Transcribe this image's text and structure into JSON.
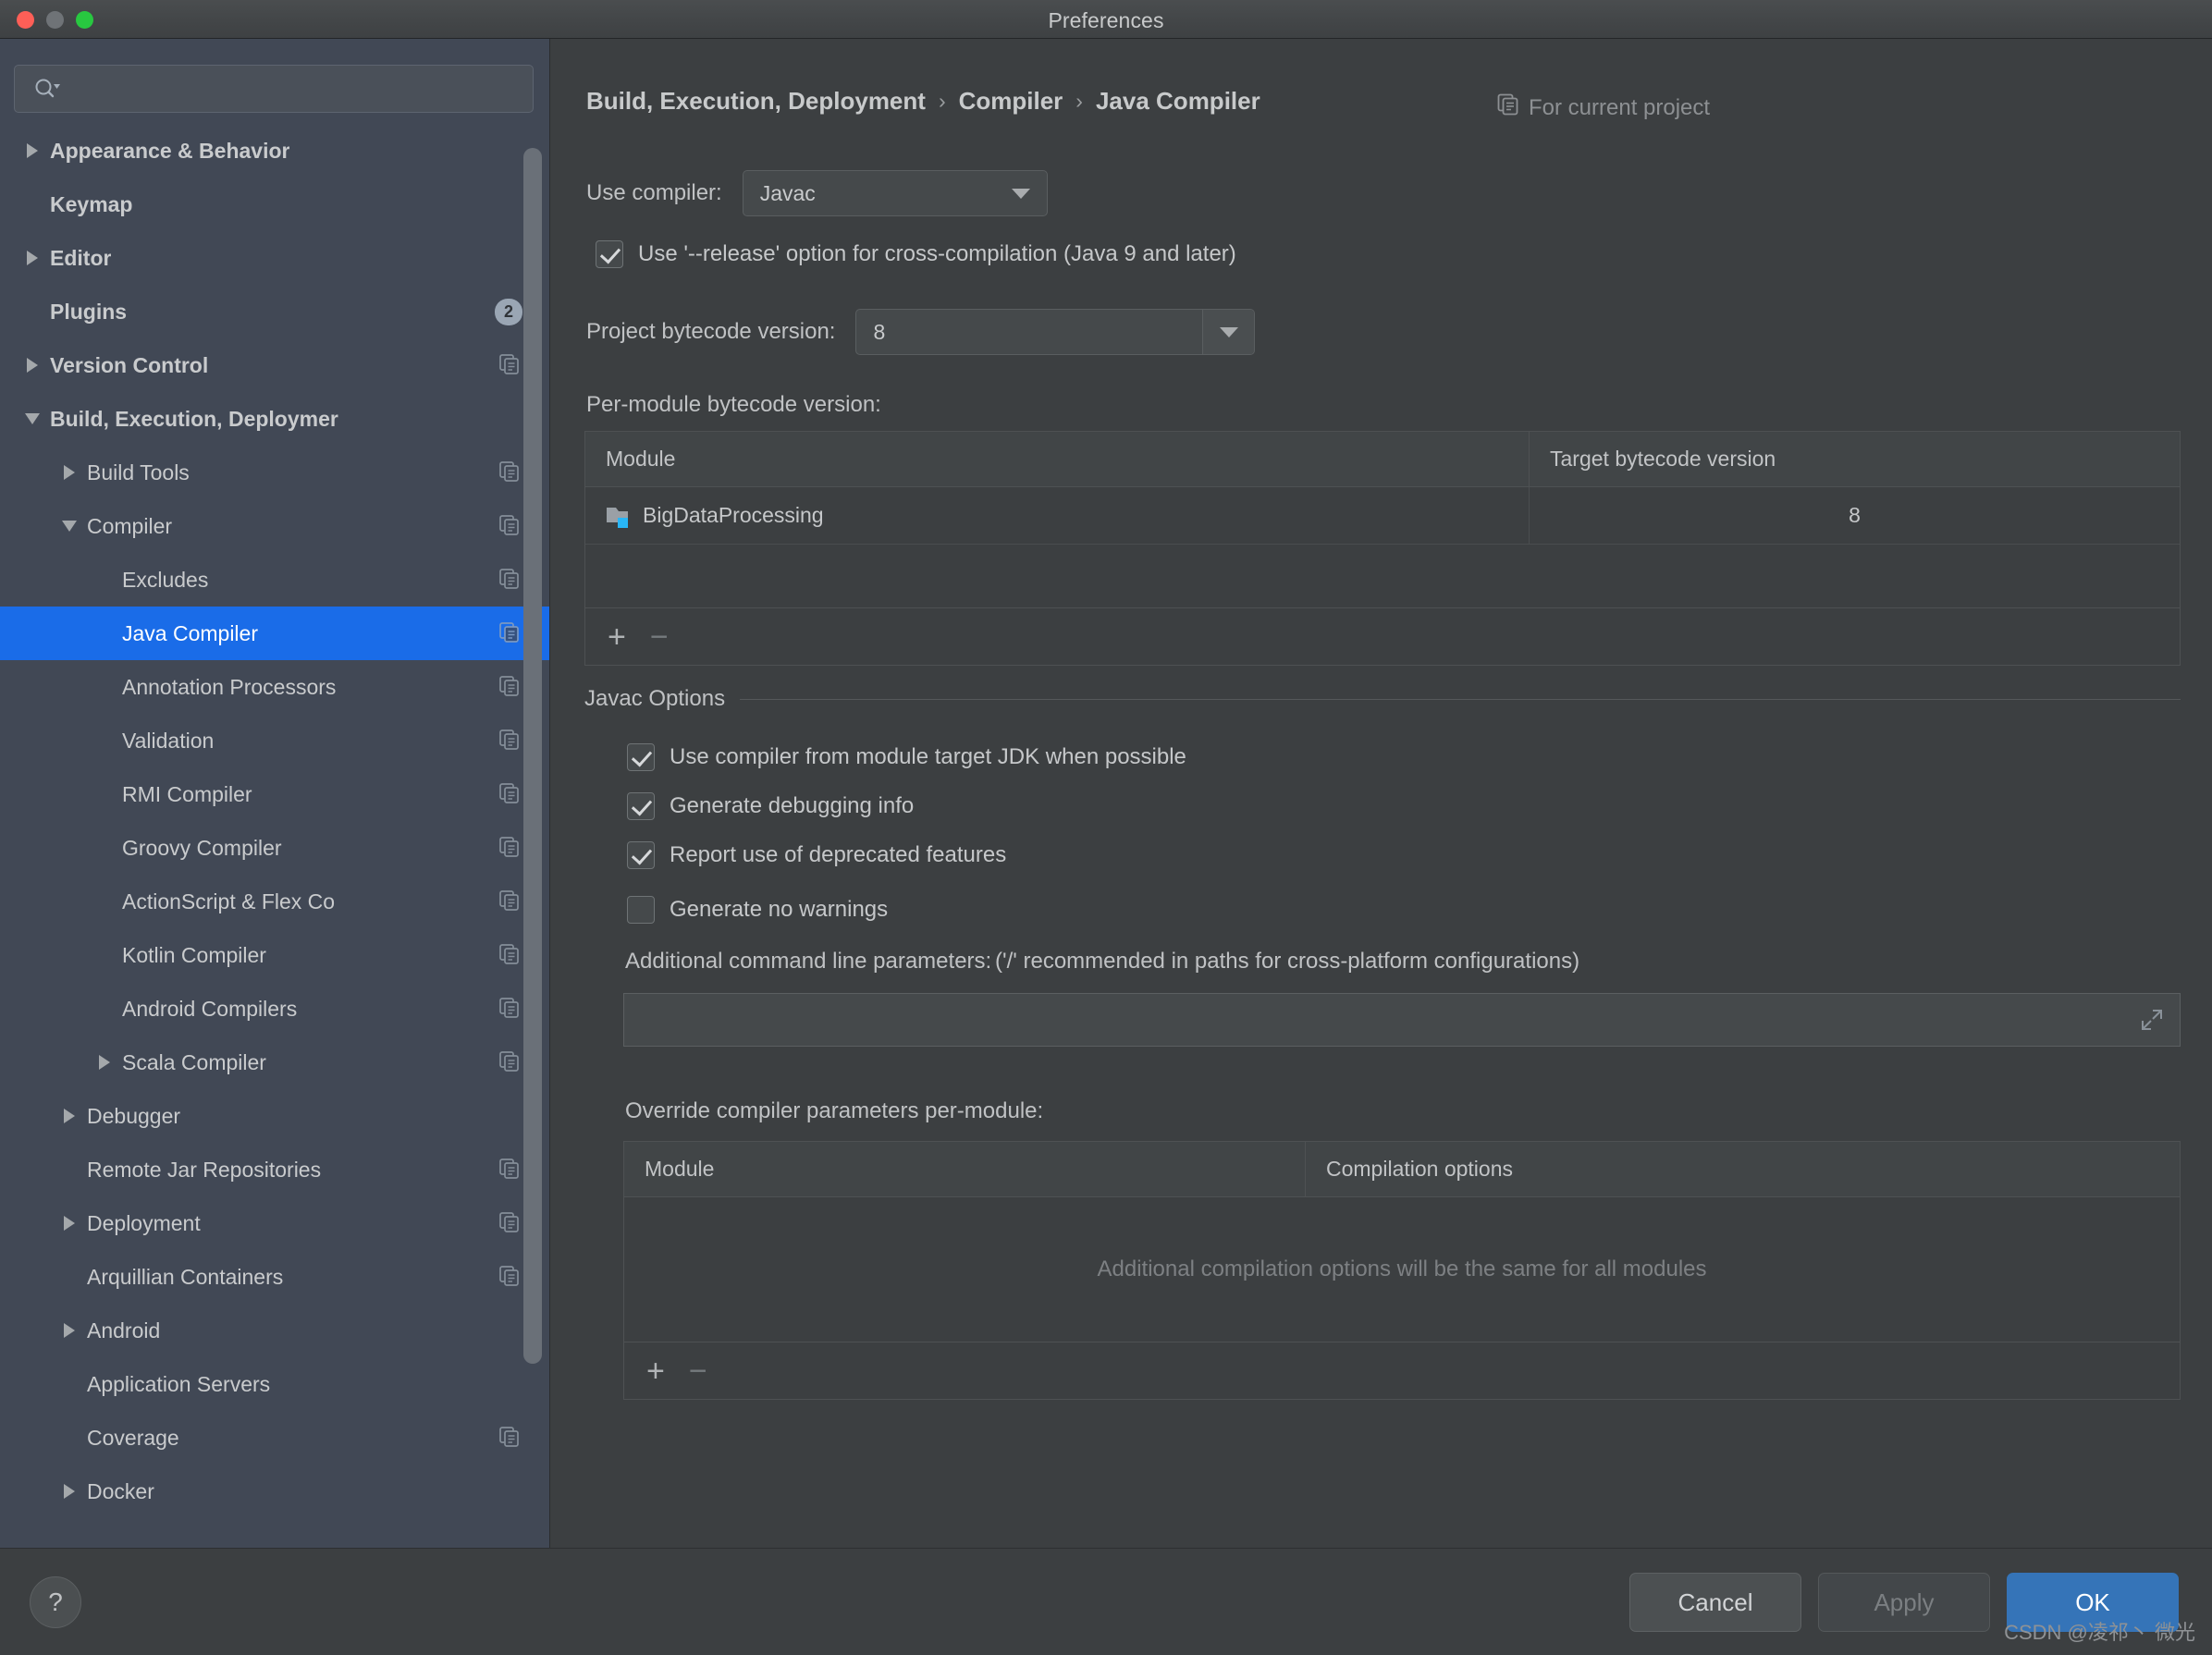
{
  "window": {
    "title": "Preferences",
    "traffic_lights": [
      "close",
      "minimize",
      "zoom"
    ]
  },
  "sidebar": {
    "search": {
      "value": "",
      "placeholder": ""
    },
    "items": [
      {
        "label": "Appearance & Behavior",
        "level": 0,
        "twisty": "closed",
        "selected": false,
        "badge": "",
        "copy_icon": false
      },
      {
        "label": "Keymap",
        "level": 0,
        "twisty": "none",
        "selected": false,
        "badge": "",
        "copy_icon": false
      },
      {
        "label": "Editor",
        "level": 0,
        "twisty": "closed",
        "selected": false,
        "badge": "",
        "copy_icon": false
      },
      {
        "label": "Plugins",
        "level": 0,
        "twisty": "none",
        "selected": false,
        "badge": "2",
        "copy_icon": false
      },
      {
        "label": "Version Control",
        "level": 0,
        "twisty": "closed",
        "selected": false,
        "badge": "",
        "copy_icon": true
      },
      {
        "label": "Build, Execution, Deploymer",
        "level": 0,
        "twisty": "open",
        "selected": false,
        "badge": "",
        "copy_icon": false
      },
      {
        "label": "Build Tools",
        "level": 1,
        "twisty": "closed",
        "selected": false,
        "badge": "",
        "copy_icon": true
      },
      {
        "label": "Compiler",
        "level": 1,
        "twisty": "open",
        "selected": false,
        "badge": "",
        "copy_icon": true
      },
      {
        "label": "Excludes",
        "level": 2,
        "twisty": "none",
        "selected": false,
        "badge": "",
        "copy_icon": true
      },
      {
        "label": "Java Compiler",
        "level": 2,
        "twisty": "none",
        "selected": true,
        "badge": "",
        "copy_icon": true
      },
      {
        "label": "Annotation Processors",
        "level": 2,
        "twisty": "none",
        "selected": false,
        "badge": "",
        "copy_icon": true
      },
      {
        "label": "Validation",
        "level": 2,
        "twisty": "none",
        "selected": false,
        "badge": "",
        "copy_icon": true
      },
      {
        "label": "RMI Compiler",
        "level": 2,
        "twisty": "none",
        "selected": false,
        "badge": "",
        "copy_icon": true
      },
      {
        "label": "Groovy Compiler",
        "level": 2,
        "twisty": "none",
        "selected": false,
        "badge": "",
        "copy_icon": true
      },
      {
        "label": "ActionScript & Flex Co",
        "level": 2,
        "twisty": "none",
        "selected": false,
        "badge": "",
        "copy_icon": true
      },
      {
        "label": "Kotlin Compiler",
        "level": 2,
        "twisty": "none",
        "selected": false,
        "badge": "",
        "copy_icon": true
      },
      {
        "label": "Android Compilers",
        "level": 2,
        "twisty": "none",
        "selected": false,
        "badge": "",
        "copy_icon": true
      },
      {
        "label": "Scala Compiler",
        "level": 2,
        "twisty": "closed",
        "selected": false,
        "badge": "",
        "copy_icon": true
      },
      {
        "label": "Debugger",
        "level": 1,
        "twisty": "closed",
        "selected": false,
        "badge": "",
        "copy_icon": false
      },
      {
        "label": "Remote Jar Repositories",
        "level": 1,
        "twisty": "none",
        "selected": false,
        "badge": "",
        "copy_icon": true
      },
      {
        "label": "Deployment",
        "level": 1,
        "twisty": "closed",
        "selected": false,
        "badge": "",
        "copy_icon": true
      },
      {
        "label": "Arquillian Containers",
        "level": 1,
        "twisty": "none",
        "selected": false,
        "badge": "",
        "copy_icon": true
      },
      {
        "label": "Android",
        "level": 1,
        "twisty": "closed",
        "selected": false,
        "badge": "",
        "copy_icon": false
      },
      {
        "label": "Application Servers",
        "level": 1,
        "twisty": "none",
        "selected": false,
        "badge": "",
        "copy_icon": false
      },
      {
        "label": "Coverage",
        "level": 1,
        "twisty": "none",
        "selected": false,
        "badge": "",
        "copy_icon": true
      },
      {
        "label": "Docker",
        "level": 1,
        "twisty": "closed",
        "selected": false,
        "badge": "",
        "copy_icon": false
      }
    ]
  },
  "main": {
    "breadcrumb": [
      "Build, Execution, Deployment",
      "Compiler",
      "Java Compiler"
    ],
    "breadcrumb_separator": "›",
    "for_current_project": "For current project",
    "use_compiler": {
      "label": "Use compiler:",
      "value": "Javac"
    },
    "release_option": {
      "label": "Use '--release' option for cross-compilation (Java 9 and later)",
      "checked": true
    },
    "project_bytecode": {
      "label": "Project bytecode version:",
      "value": "8"
    },
    "per_module_bytecode": {
      "label": "Per-module bytecode version:",
      "columns": [
        "Module",
        "Target bytecode version"
      ],
      "rows": [
        {
          "module": "BigDataProcessing",
          "target": "8"
        }
      ],
      "add_label": "+",
      "remove_label": "−"
    },
    "javac_options": {
      "title": "Javac Options",
      "checkboxes": [
        {
          "label": "Use compiler from module target JDK when possible",
          "checked": true
        },
        {
          "label": "Generate debugging info",
          "checked": true
        },
        {
          "label": "Report use of deprecated features",
          "checked": true
        },
        {
          "label": "Generate no warnings",
          "checked": false
        }
      ],
      "additional_params_label": "Additional command line parameters:",
      "additional_params_hint": "('/' recommended in paths for cross-platform configurations)",
      "additional_params_value": ""
    },
    "override_per_module": {
      "label": "Override compiler parameters per-module:",
      "columns": [
        "Module",
        "Compilation options"
      ],
      "empty_message": "Additional compilation options will be the same for all modules",
      "add_label": "+",
      "remove_label": "−"
    }
  },
  "footer": {
    "help_label": "?",
    "cancel_label": "Cancel",
    "apply_label": "Apply",
    "ok_label": "OK",
    "watermark": "CSDN @凌祁丶 微光"
  },
  "colors": {
    "accent_selection": "#1a6ce8",
    "primary_button": "#3574b8",
    "sidebar_bg": "#414855",
    "panel_bg": "#3c3f41",
    "module_badge": "#29b6f6"
  }
}
